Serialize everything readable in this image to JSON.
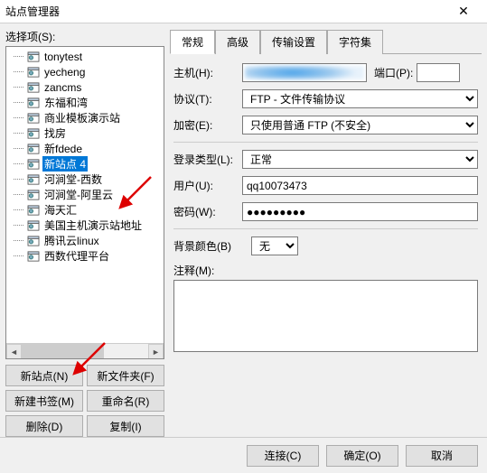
{
  "window": {
    "title": "站点管理器"
  },
  "left": {
    "label": "选择项(S):",
    "items": [
      {
        "label": "tonytest",
        "selected": false
      },
      {
        "label": "yecheng",
        "selected": false
      },
      {
        "label": "zancms",
        "selected": false
      },
      {
        "label": "东福和湾",
        "selected": false
      },
      {
        "label": "商业模板演示站",
        "selected": false
      },
      {
        "label": "找房",
        "selected": false
      },
      {
        "label": "新fdede",
        "selected": false
      },
      {
        "label": "新站点 4",
        "selected": true
      },
      {
        "label": "河涧堂-西数",
        "selected": false
      },
      {
        "label": "河涧堂-阿里云",
        "selected": false
      },
      {
        "label": "海天汇",
        "selected": false
      },
      {
        "label": "美国主机演示站地址",
        "selected": false
      },
      {
        "label": "腾讯云linux",
        "selected": false
      },
      {
        "label": "西数代理平台",
        "selected": false
      }
    ],
    "buttons": {
      "new_site": "新站点(N)",
      "new_folder": "新文件夹(F)",
      "new_bookmark": "新建书签(M)",
      "rename": "重命名(R)",
      "delete": "删除(D)",
      "copy": "复制(I)"
    }
  },
  "tabs": {
    "general": "常规",
    "advanced": "高级",
    "transfer": "传输设置",
    "charset": "字符集"
  },
  "form": {
    "host_label": "主机(H):",
    "host_value": "1",
    "port_label": "端口(P):",
    "port_value": "",
    "protocol_label": "协议(T):",
    "protocol_value": "FTP - 文件传输协议",
    "encryption_label": "加密(E):",
    "encryption_value": "只使用普通 FTP (不安全)",
    "logon_label": "登录类型(L):",
    "logon_value": "正常",
    "user_label": "用户(U):",
    "user_value": "qq10073473",
    "pass_label": "密码(W):",
    "pass_value": "●●●●●●●●●",
    "bg_label": "背景颜色(B)",
    "bg_value": "无",
    "notes_label": "注释(M):",
    "notes_value": ""
  },
  "footer": {
    "connect": "连接(C)",
    "ok": "确定(O)",
    "cancel": "取消"
  }
}
